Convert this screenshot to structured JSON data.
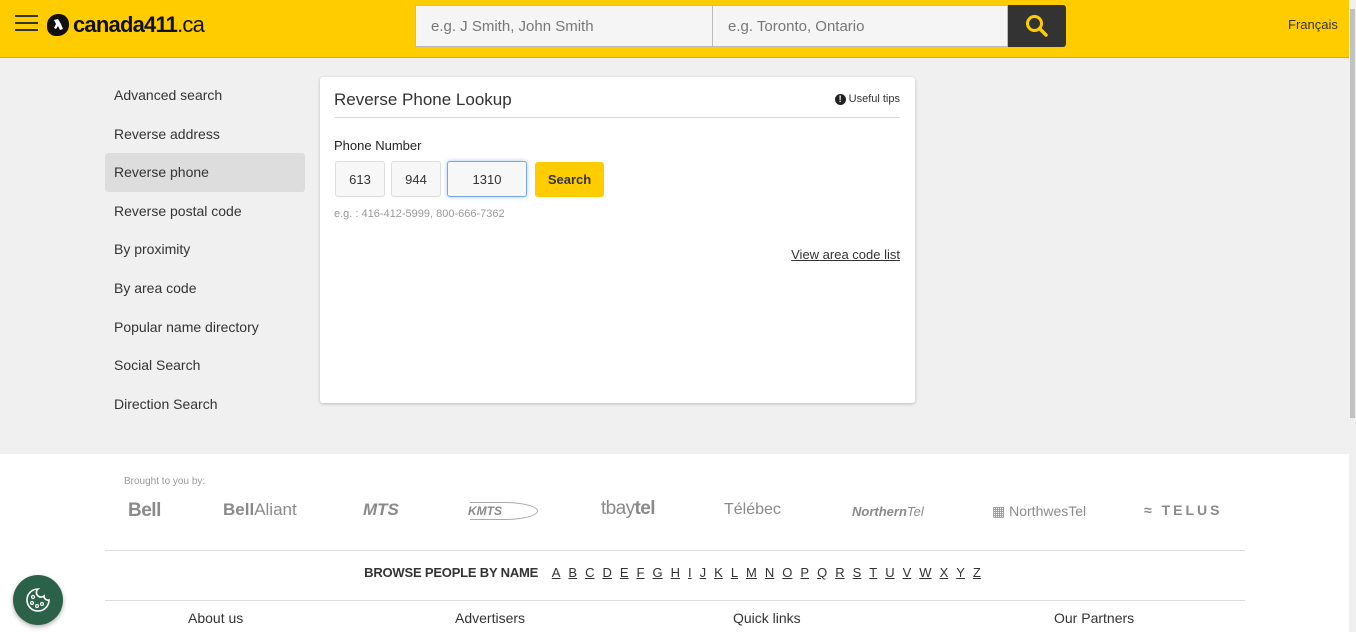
{
  "header": {
    "logo_text": "canada411",
    "logo_tld": ".ca",
    "search_who_placeholder": "e.g. J Smith, John Smith",
    "search_where_placeholder": "e.g. Toronto, Ontario",
    "language_link": "Français"
  },
  "colors": {
    "brand_yellow": "#ffcc00",
    "search_button": "#333333",
    "cookie_green": "#2b6149"
  },
  "sidebar": {
    "items": [
      {
        "label": "Advanced search",
        "active": false
      },
      {
        "label": "Reverse address",
        "active": false
      },
      {
        "label": "Reverse phone",
        "active": true
      },
      {
        "label": "Reverse postal code",
        "active": false
      },
      {
        "label": "By proximity",
        "active": false
      },
      {
        "label": "By area code",
        "active": false
      },
      {
        "label": "Popular name directory",
        "active": false
      },
      {
        "label": "Social Search",
        "active": false
      },
      {
        "label": "Direction Search",
        "active": false
      }
    ]
  },
  "lookup": {
    "title": "Reverse Phone Lookup",
    "tips_label": "Useful tips",
    "phone_label": "Phone Number",
    "area_code": "613",
    "prefix": "944",
    "line_number": "1310",
    "search_button": "Search",
    "example": "e.g. : 416-412-5999, 800-666-7362",
    "area_code_link": "View area code list"
  },
  "footer": {
    "brought_by": "Brought to you by:",
    "partners": {
      "bell": "Bell",
      "bellaliant_a": "Bell",
      "bellaliant_b": "Aliant",
      "mts": "MTS",
      "kmts": "KMTS",
      "tbaytel_a": "tbay",
      "tbaytel_b": "tel",
      "telebec": "Télébec",
      "northerntel_a": "Northern",
      "northerntel_b": "Tel",
      "northwestel": "NorthwesTel",
      "telus": "TELUS"
    },
    "browse_label": "BROWSE PEOPLE BY NAME",
    "letters": [
      "A",
      "B",
      "C",
      "D",
      "E",
      "F",
      "G",
      "H",
      "I",
      "J",
      "K",
      "L",
      "M",
      "N",
      "O",
      "P",
      "Q",
      "R",
      "S",
      "T",
      "U",
      "V",
      "W",
      "X",
      "Y",
      "Z"
    ],
    "columns": [
      "About us",
      "Advertisers",
      "Quick links",
      "Our Partners"
    ]
  }
}
